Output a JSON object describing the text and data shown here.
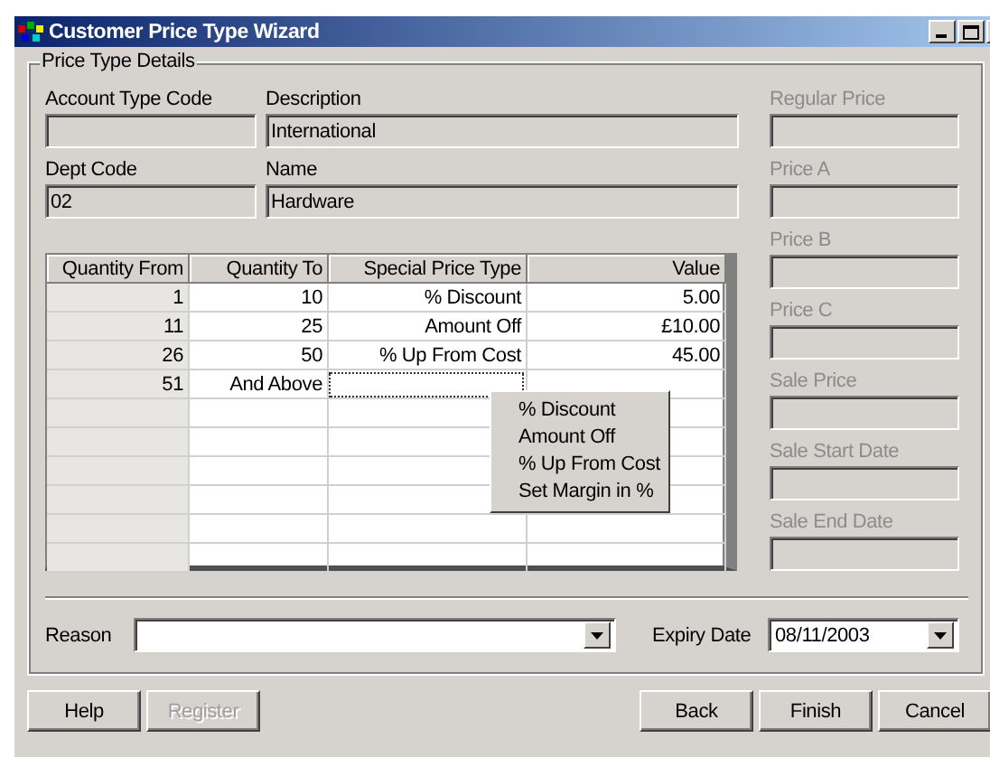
{
  "window": {
    "title": "Customer Price Type Wizard"
  },
  "group": {
    "title": "Price Type Details",
    "fields": [
      {
        "label": "Account Type Code"
      },
      {
        "label": "Description",
        "value": "International"
      },
      {
        "label": "Dept Code",
        "value": "02"
      },
      {
        "label": "Name",
        "value": "Hardware"
      }
    ],
    "price_fields": [
      {
        "label": "Regular Price",
        "disabled": true
      },
      {
        "label": "Price A",
        "disabled": true
      },
      {
        "label": "Price B",
        "disabled": true
      },
      {
        "label": "Price C",
        "disabled": true
      },
      {
        "label": "Sale Price",
        "disabled": true
      },
      {
        "label": "Sale Start Date",
        "disabled": true
      },
      {
        "label": "Sale End Date",
        "disabled": true
      }
    ],
    "table": {
      "columns": [
        "Quantity From",
        "Quantity To",
        "Special Price Type",
        "Value"
      ],
      "rows": [
        {
          "cells": [
            "1",
            "10",
            "% Discount",
            "5.00"
          ],
          "editing": false
        },
        {
          "cells": [
            "11",
            "25",
            "Amount Off",
            "£10.00"
          ],
          "editing": false
        },
        {
          "cells": [
            "26",
            "50",
            "% Up From Cost",
            "45.00"
          ],
          "editing": false
        },
        {
          "cells": [
            "51",
            "And Above"
          ],
          "editing": true
        }
      ]
    },
    "menu": {
      "items": [
        "% Discount",
        "Amount Off",
        "% Up From Cost",
        "Set Margin in %"
      ]
    },
    "reason": {
      "label": "Reason"
    },
    "expiry": {
      "label": "Expiry Date",
      "value": "08/11/2003"
    }
  },
  "left_buttons": [
    {
      "label": "Help",
      "disabled": false
    },
    {
      "label": "Register",
      "disabled": true
    }
  ],
  "right_buttons": [
    {
      "label": "Back",
      "disabled": false
    },
    {
      "label": "Finish",
      "disabled": false
    },
    {
      "label": "Cancel",
      "disabled": false
    }
  ]
}
